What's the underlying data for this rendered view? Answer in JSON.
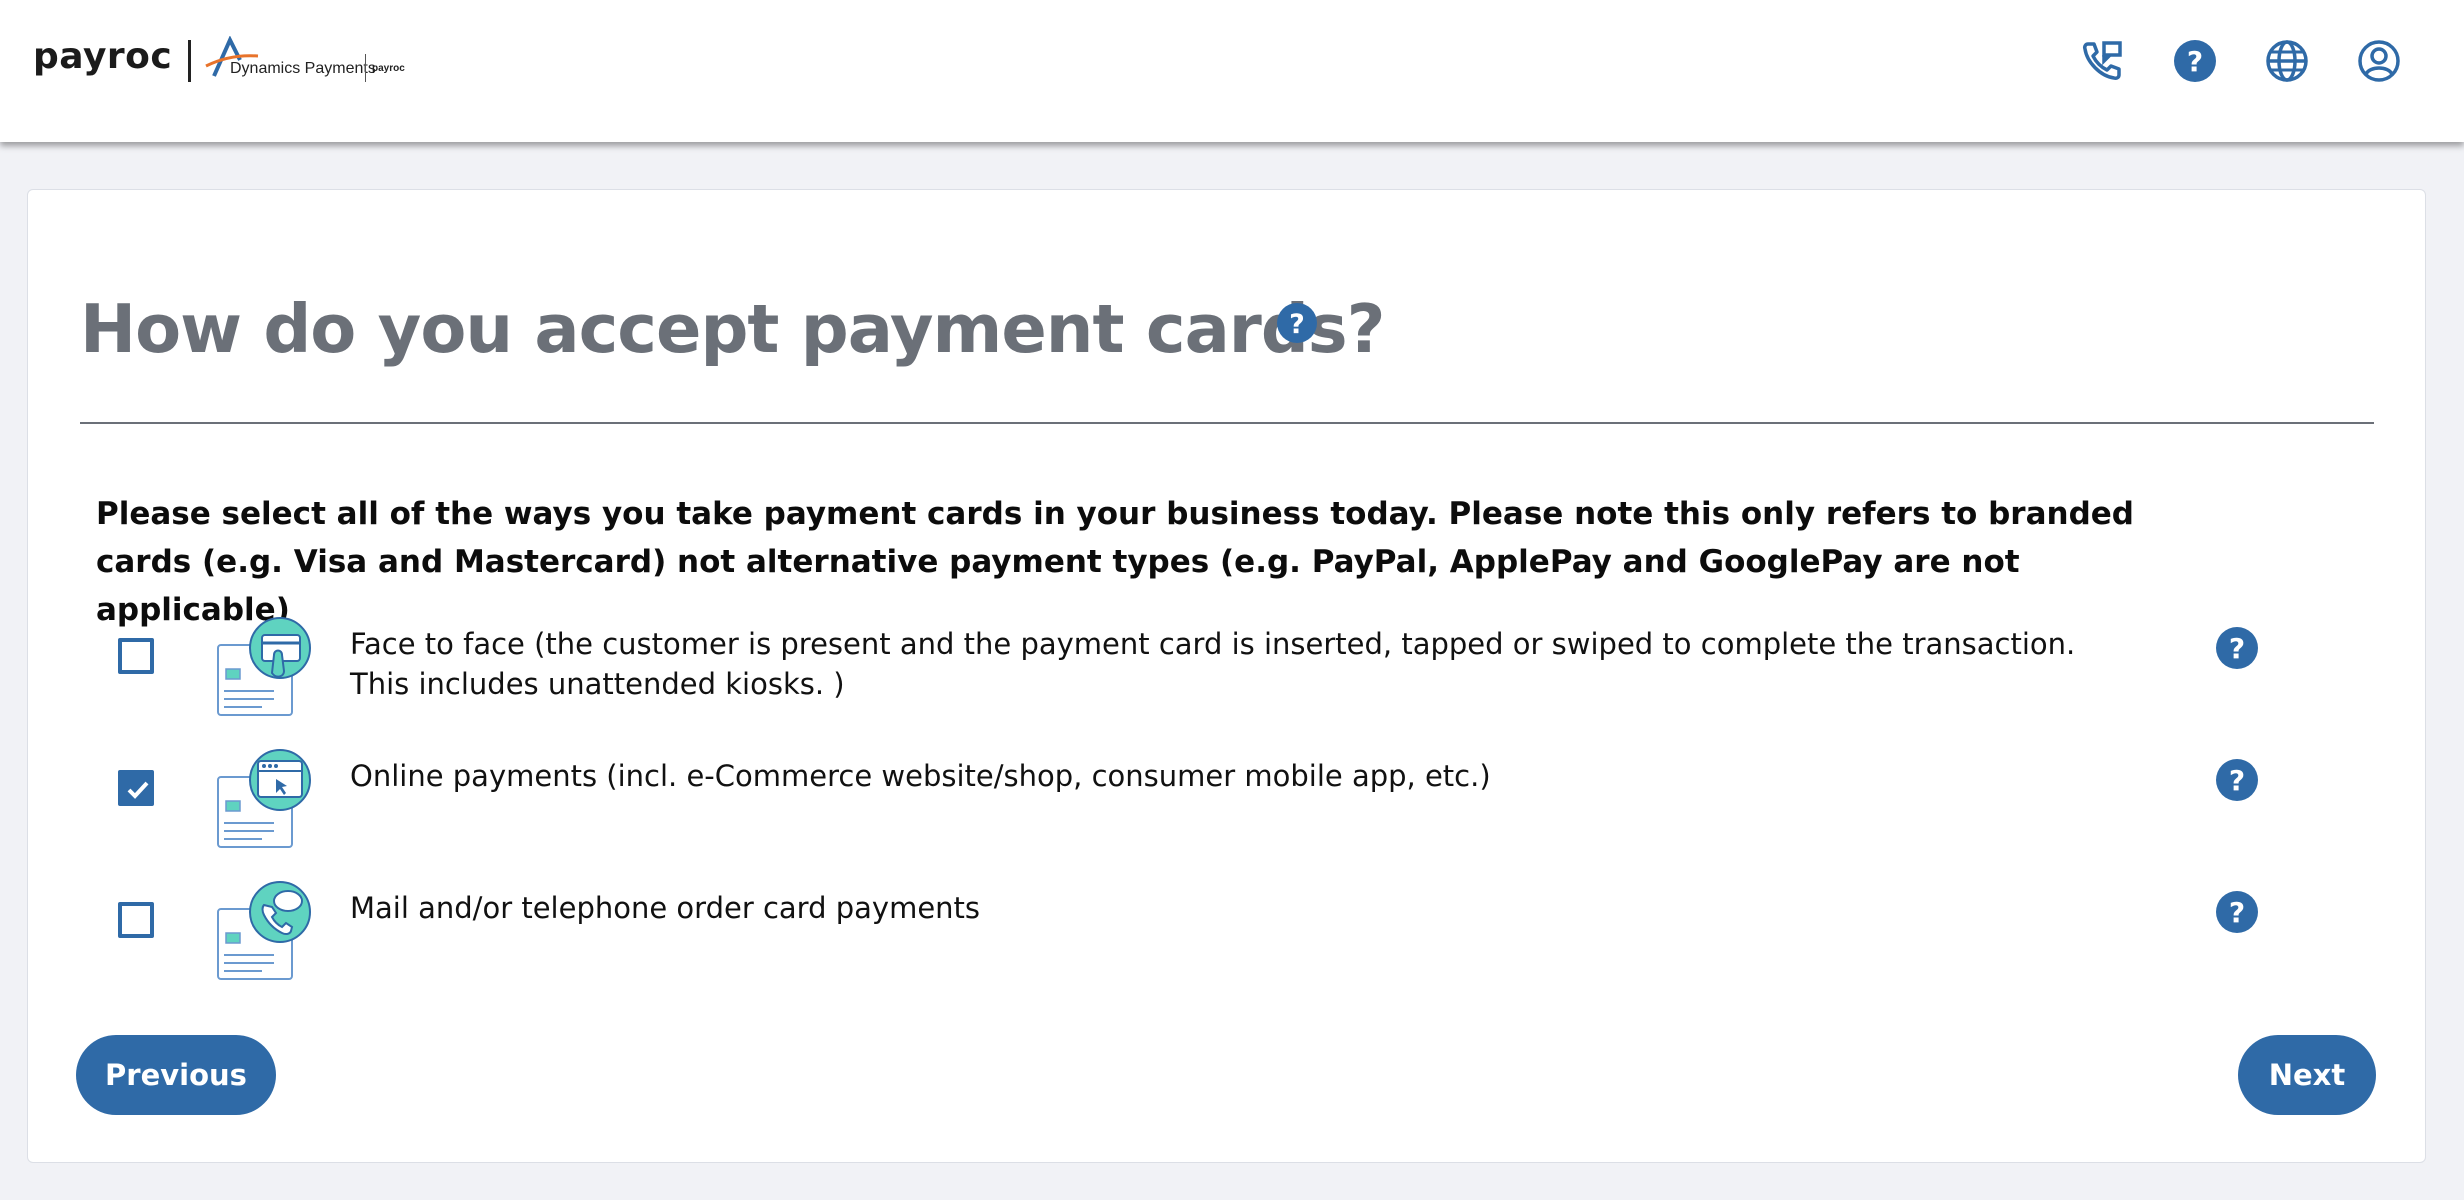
{
  "header": {
    "brand": "payroc",
    "partner_name": "Dynamics Payments",
    "partner_sub": "payroc",
    "icons": [
      "phone-callback-icon",
      "help-icon",
      "globe-icon",
      "user-account-icon"
    ]
  },
  "main": {
    "title": "How do you accept payment cards?",
    "instructions": "Please select all of the ways you take payment cards in your business today. Please note this only refers to branded cards (e.g. Visa and Mastercard) not alternative payment types (e.g. PayPal, ApplePay and GooglePay are not applicable)",
    "options": [
      {
        "label": "Face to face (the customer is present and the payment card is inserted, tapped or swiped to complete the transaction. This includes unattended kiosks. )",
        "checked": false,
        "icon": "card-terminal-illustration"
      },
      {
        "label": "Online payments (incl. e-Commerce website/shop, consumer mobile app, etc.)",
        "checked": true,
        "icon": "online-browser-illustration"
      },
      {
        "label": "Mail and/or telephone order card payments",
        "checked": false,
        "icon": "phone-order-illustration"
      }
    ]
  },
  "nav": {
    "previous_label": "Previous",
    "next_label": "Next"
  },
  "colors": {
    "accent": "#2f6aa7",
    "title": "#6b7078",
    "background": "#f1f2f6",
    "illustration_teal": "#5fd3c0"
  }
}
